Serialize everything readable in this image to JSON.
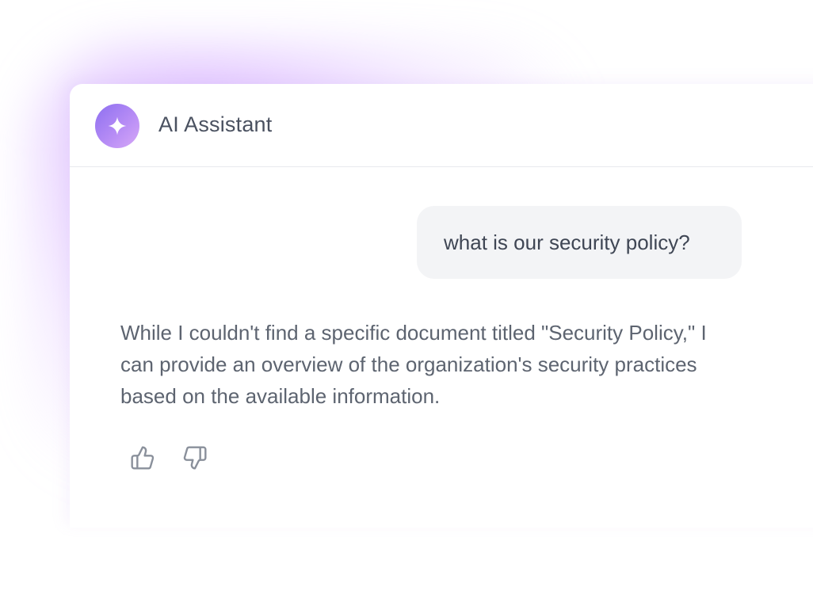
{
  "header": {
    "title": "AI Assistant",
    "avatar_icon": "sparkle-icon"
  },
  "messages": {
    "user": "what is our security policy?",
    "assistant": "While I couldn't find a specific document titled \"Security Policy,\" I can provide an overview of the organization's security practices based on the available information."
  },
  "feedback": {
    "up_icon": "thumbs-up-icon",
    "down_icon": "thumbs-down-icon"
  },
  "colors": {
    "accent_start": "#8d6ff0",
    "accent_end": "#d7a8f7",
    "bubble_bg": "#f3f4f6",
    "text": "#5d6470"
  }
}
